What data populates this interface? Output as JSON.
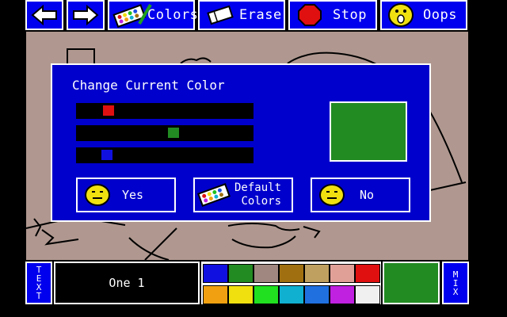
{
  "toolbar": {
    "back_label": "back",
    "forward_label": "forward",
    "colors_label": "Colors",
    "erase_label": "Erase",
    "stop_label": "Stop",
    "oops_label": "Oops"
  },
  "dialog": {
    "title": "Change Current Color",
    "red_level": 0.16,
    "green_level": 0.55,
    "blue_level": 0.15,
    "preview_color": "#228b22",
    "yes_label": "Yes",
    "default_line1": "Default",
    "default_line2": "Colors",
    "no_label": "No"
  },
  "bottom": {
    "text_tool_label": "TEXT",
    "font_name": "One 1",
    "mix_label": "MIX",
    "current_color": "#228b22",
    "palette_row1": [
      "#1010e0",
      "#228b22",
      "#a08880",
      "#a07010",
      "#c0a060",
      "#e0a098",
      "#e01010"
    ],
    "palette_row2": [
      "#f0a010",
      "#f0e010",
      "#20e020",
      "#10b0d0",
      "#2070e0",
      "#c020e0",
      "#f0f0f0"
    ]
  }
}
